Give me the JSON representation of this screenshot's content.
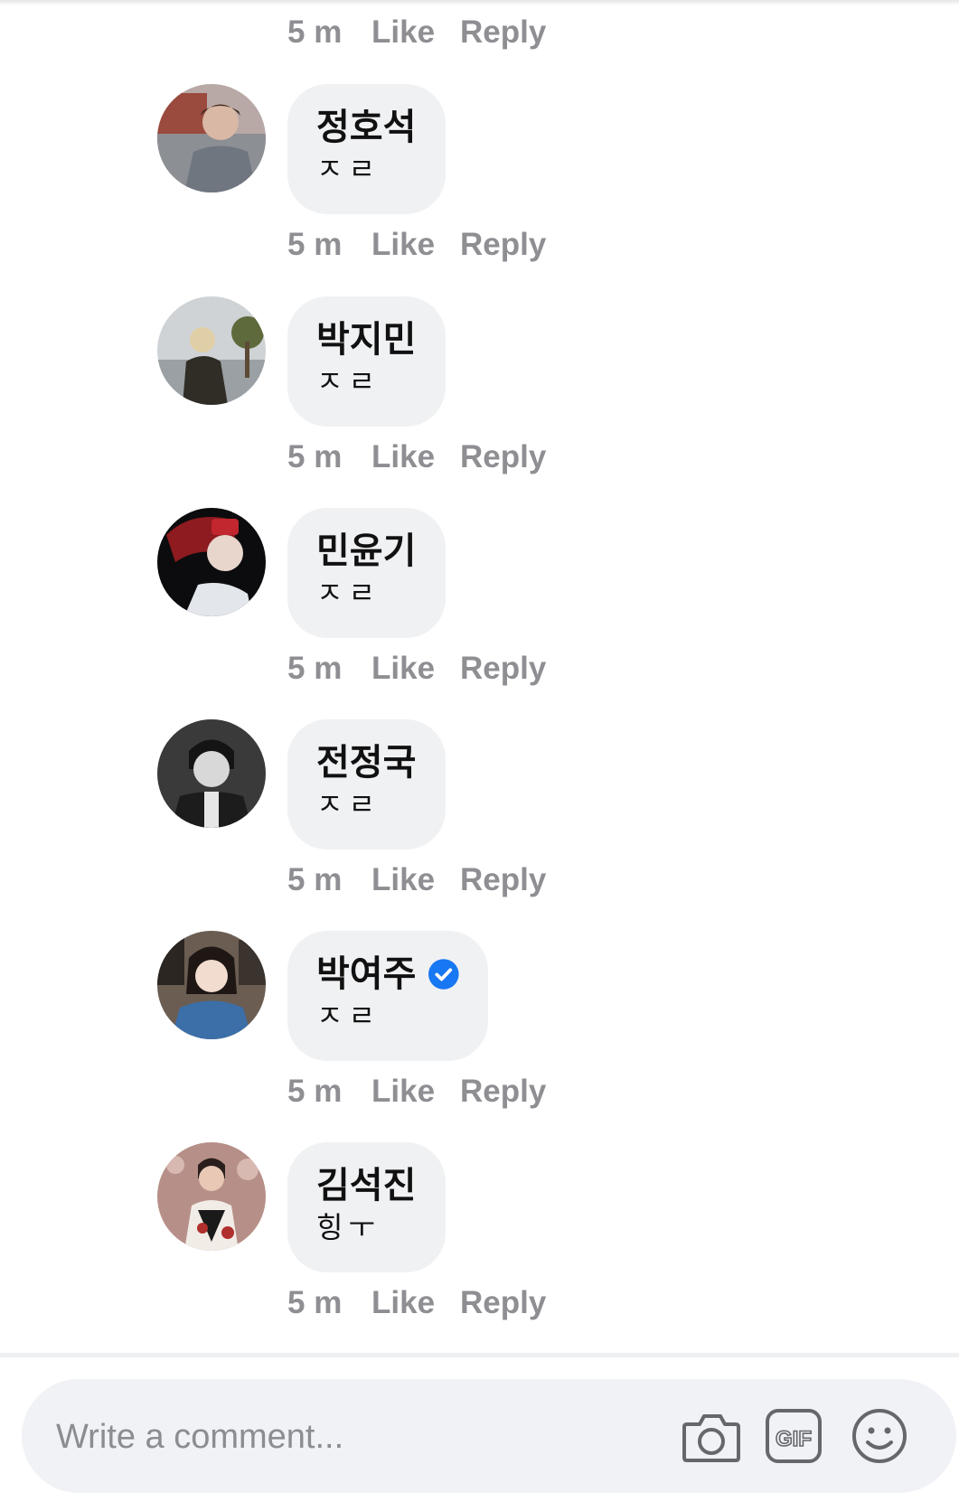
{
  "top_actions": {
    "time": "5 m",
    "like": "Like",
    "reply": "Reply"
  },
  "comments": [
    {
      "name": "정호석",
      "text": "ㅈㄹ",
      "verified": false,
      "time": "5 m",
      "like": "Like",
      "reply": "Reply"
    },
    {
      "name": "박지민",
      "text": "ㅈㄹ",
      "verified": false,
      "time": "5 m",
      "like": "Like",
      "reply": "Reply"
    },
    {
      "name": "민윤기",
      "text": "ㅈㄹ",
      "verified": false,
      "time": "5 m",
      "like": "Like",
      "reply": "Reply"
    },
    {
      "name": "전정국",
      "text": "ㅈㄹ",
      "verified": false,
      "time": "5 m",
      "like": "Like",
      "reply": "Reply"
    },
    {
      "name": "박여주",
      "text": "ㅈㄹ",
      "verified": true,
      "time": "5 m",
      "like": "Like",
      "reply": "Reply"
    },
    {
      "name": "김석진",
      "text": "힝ㅜ",
      "verified": false,
      "time": "5 m",
      "like": "Like",
      "reply": "Reply"
    }
  ],
  "composer": {
    "placeholder": "Write a comment...",
    "icons": [
      "camera-icon",
      "gif-icon",
      "emoji-icon"
    ]
  },
  "colors": {
    "bubble": "#f0f1f3",
    "action_text": "#8e8e93",
    "verified": "#1877f2",
    "composer_bg": "#f0f2f5"
  }
}
